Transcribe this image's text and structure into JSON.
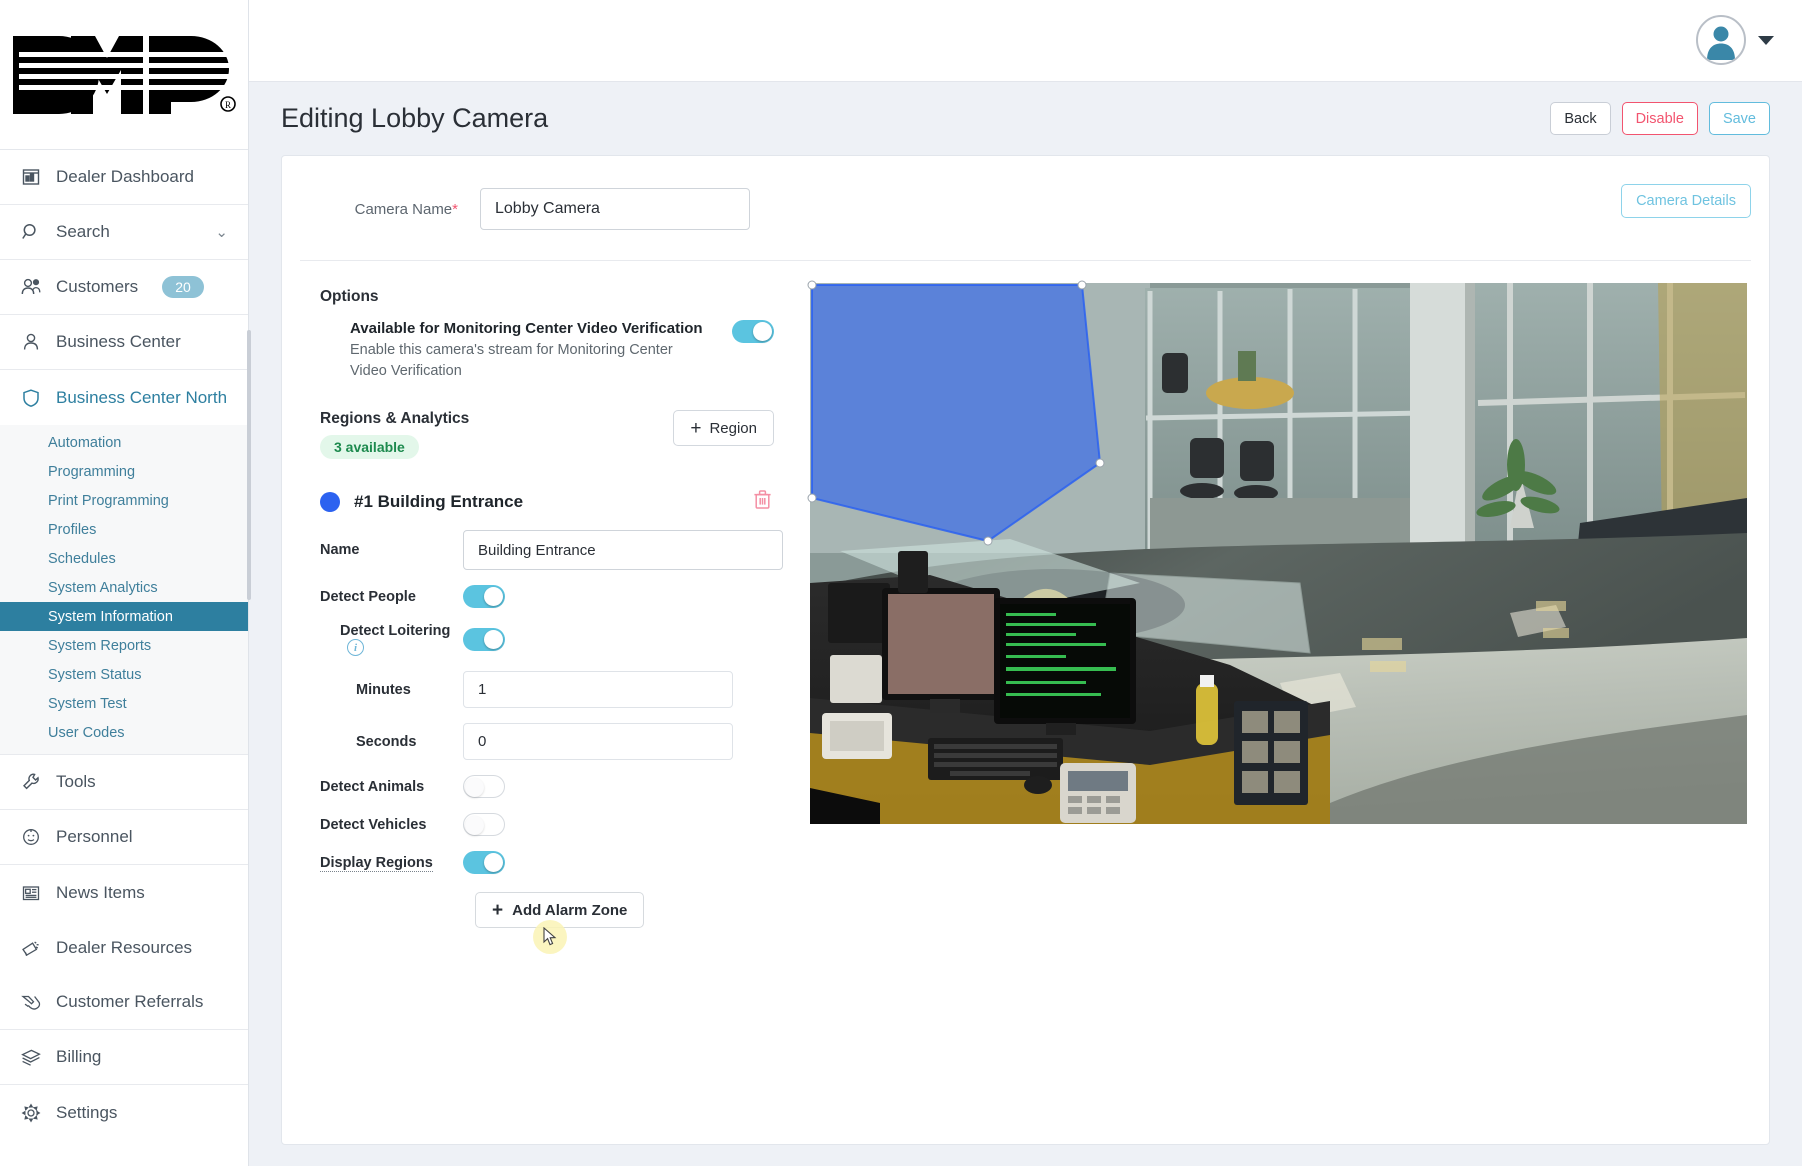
{
  "app": {
    "logo_alt": "DMP",
    "avatar_icon": "user-avatar-icon",
    "caret_icon": "chevron-down-icon"
  },
  "sidebar": {
    "items": [
      {
        "label": "Dealer Dashboard",
        "icon": "dashboard-icon"
      },
      {
        "label": "Search",
        "icon": "search-icon",
        "chevron": "⌄"
      },
      {
        "label": "Customers",
        "icon": "customers-icon",
        "badge": "20"
      },
      {
        "label": "Business Center",
        "icon": "person-icon"
      },
      {
        "label": "Business Center North",
        "icon": "shield-icon",
        "active": true
      }
    ],
    "subitems": [
      {
        "label": "Automation"
      },
      {
        "label": "Programming"
      },
      {
        "label": "Print Programming"
      },
      {
        "label": "Profiles"
      },
      {
        "label": "Schedules"
      },
      {
        "label": "System Analytics"
      },
      {
        "label": "System Information",
        "selected": true
      },
      {
        "label": "System Reports"
      },
      {
        "label": "System Status"
      },
      {
        "label": "System Test"
      },
      {
        "label": "User Codes"
      }
    ],
    "items_bottom": [
      {
        "label": "Tools",
        "icon": "wrench-icon"
      },
      {
        "label": "Personnel",
        "icon": "personnel-icon"
      },
      {
        "label": "News Items",
        "icon": "news-icon"
      },
      {
        "label": "Dealer Resources",
        "icon": "megaphone-icon"
      },
      {
        "label": "Customer Referrals",
        "icon": "handshake-icon"
      },
      {
        "label": "Billing",
        "icon": "billing-icon"
      },
      {
        "label": "Settings",
        "icon": "gear-icon"
      }
    ]
  },
  "header": {
    "title": "Editing Lobby Camera",
    "back_label": "Back",
    "disable_label": "Disable",
    "save_label": "Save"
  },
  "camera_name": {
    "label": "Camera Name",
    "required_mark": "*",
    "value": "Lobby Camera",
    "details_button": "Camera Details"
  },
  "options": {
    "section_title": "Options",
    "monitoring": {
      "title": "Available for Monitoring Center Video Verification",
      "description": "Enable this camera's stream for Monitoring Center Video Verification",
      "enabled": true
    }
  },
  "regions": {
    "section_title": "Regions & Analytics",
    "available_badge": "3 available",
    "add_region_label": "Region",
    "add_region_icon": "plus-icon",
    "region": {
      "number": "#1",
      "title": "#1 Building Entrance",
      "color": "#2c62f0",
      "delete_icon": "trash-icon",
      "name_label": "Name",
      "name_value": "Building Entrance",
      "detect_people_label": "Detect People",
      "detect_people": true,
      "detect_loitering_label": "Detect Loitering",
      "detect_loitering_info_icon": "info-icon",
      "detect_loitering": true,
      "minutes_label": "Minutes",
      "minutes_value": "1",
      "seconds_label": "Seconds",
      "seconds_value": "0",
      "detect_animals_label": "Detect Animals",
      "detect_animals": false,
      "detect_vehicles_label": "Detect Vehicles",
      "detect_vehicles": false,
      "display_regions_label": "Display Regions",
      "display_regions": true,
      "add_alarm_zone_label": "Add Alarm Zone",
      "add_alarm_zone_icon": "plus-icon"
    }
  },
  "preview": {
    "name": "lobby-camera-preview",
    "overlay_polygon_color": "#2c62f0",
    "handles": 5
  },
  "colors": {
    "accent": "#2d7fa0",
    "toggle_on": "#5bc4e0",
    "danger": "#f2546f",
    "success": "#1d8a4e",
    "region_blue": "#2c62f0"
  }
}
